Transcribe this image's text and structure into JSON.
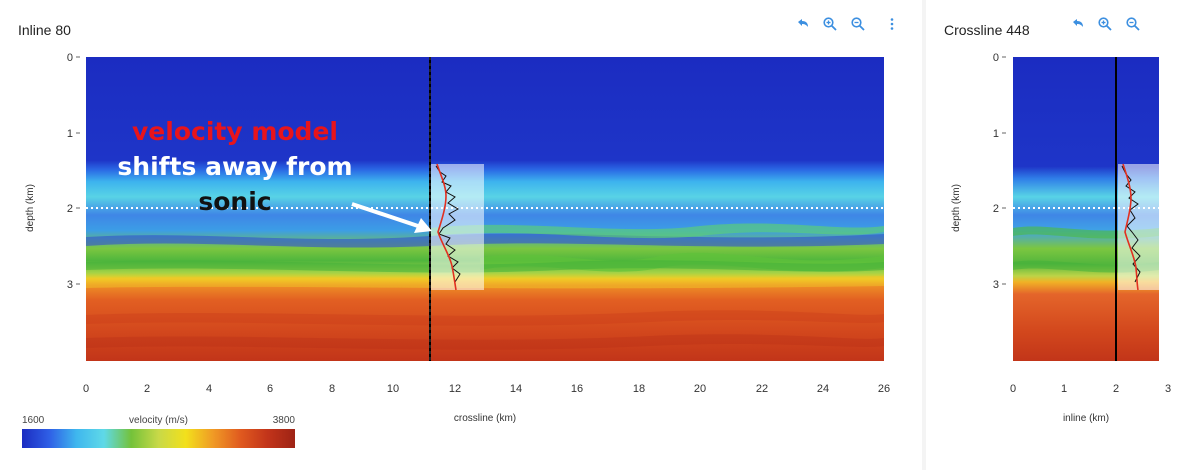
{
  "inline_panel": {
    "title": "Inline 80",
    "x_label": "crossline (km)",
    "y_label": "depth (km)",
    "x_ticks": [
      "0",
      "2",
      "4",
      "6",
      "8",
      "10",
      "12",
      "14",
      "16",
      "18",
      "20",
      "22",
      "24",
      "26"
    ],
    "y_ticks": [
      "0",
      "1",
      "2",
      "3"
    ],
    "toolbar": [
      "undo-icon",
      "zoom-in-icon",
      "zoom-out-icon",
      "more-vertical-icon"
    ]
  },
  "crossline_panel": {
    "title": "Crossline 448",
    "x_label": "inline (km)",
    "y_label": "depth (km)",
    "x_ticks": [
      "0",
      "1",
      "2",
      "3"
    ],
    "y_ticks": [
      "0",
      "1",
      "2",
      "3"
    ],
    "toolbar": [
      "undo-icon",
      "zoom-in-icon",
      "zoom-out-icon"
    ]
  },
  "annotation": {
    "line1": "velocity model",
    "line2": "shifts away from",
    "line3": "sonic",
    "line1_color": "#e8141b"
  },
  "colorbar": {
    "min_label": "1600",
    "title": "velocity (m/s)",
    "max_label": "3800",
    "stops": [
      "#1b2cc1",
      "#2f5fe6",
      "#3fb7ee",
      "#5fd9e8",
      "#74c23a",
      "#c8d948",
      "#f2e01c",
      "#f09a25",
      "#e05a1f",
      "#c2341a",
      "#9e2315"
    ]
  },
  "colors": {
    "toolbar_accent": "#3c8fe0",
    "well_curve": "#111111",
    "model_curve": "#e23020",
    "marker_line": "#000000"
  }
}
